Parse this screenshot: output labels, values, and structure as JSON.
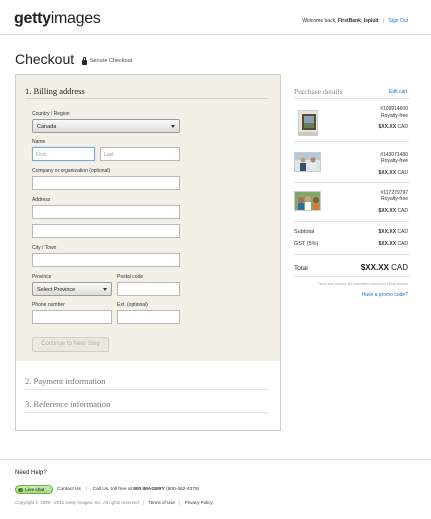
{
  "header": {
    "logo_bold": "getty",
    "logo_regular": "images",
    "welcome_prefix": "Welcome back,",
    "username": "FirstBank_Ispluit",
    "separator": "|",
    "sign_out": "Sign Out"
  },
  "page": {
    "title": "Checkout",
    "secure_label": "Secure Checkout"
  },
  "billing": {
    "title": "1. Billing address",
    "country_label": "Country / Region",
    "country_value": "Canada",
    "name_label": "Name",
    "first_placeholder": "First",
    "last_placeholder": "Last",
    "company_label": "Company or organization (optional)",
    "address_label": "Address",
    "city_label": "City / Town",
    "province_label": "Province",
    "province_value": "Select Province",
    "postal_label": "Postal code",
    "phone_label": "Phone number",
    "ext_label": "Ext. (optional)",
    "continue_button": "Continue to Next Step"
  },
  "steps": {
    "payment": "2. Payment information",
    "reference": "3. Reference information"
  },
  "purchase": {
    "title": "Purchase details",
    "edit_cart": "Edit cart",
    "items": [
      {
        "id": "#109914600",
        "type": "Royalty-free",
        "price": "$XX.XX",
        "currency": "CAD"
      },
      {
        "id": "#143071480",
        "type": "Royalty-free",
        "price": "$XX.XX",
        "currency": "CAD"
      },
      {
        "id": "#117279797",
        "type": "Royalty-free",
        "price": "$XX.XX",
        "currency": "CAD"
      }
    ],
    "subtotal_label": "Subtotal",
    "subtotal_value": "$XX.XX",
    "subtotal_currency": "CAD",
    "gst_label": "GST (5%)",
    "gst_value": "$XX.XX",
    "gst_currency": "CAD",
    "total_label": "Total",
    "total_value": "$XX.XX",
    "total_currency": "CAD",
    "fine_print": "Taxes and currency are determined using your billing address",
    "promo": "Have a promo code?"
  },
  "footer": {
    "need_help": "Need Help?",
    "live_chat": "Live chat",
    "contact_us": "Contact Us",
    "toll_free_prefix": "Call Us, toll free at",
    "toll_free_number": "800 IMAGERY",
    "toll_free_alt": "(800-462-4379)",
    "copyright": "Copyright © 1999 - 2012 Getty Images, Inc. All rights reserved",
    "terms": "Terms of Use",
    "privacy": "Privacy Policy"
  },
  "colors": {
    "link": "#1a6fc9",
    "billing_bg": "#f3f0e8",
    "live_chat_green": "#a6d67f"
  }
}
